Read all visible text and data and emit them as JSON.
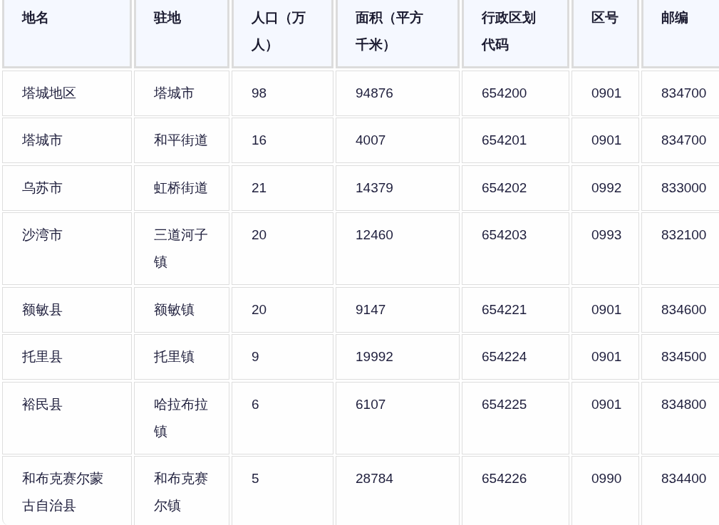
{
  "table": {
    "columns": [
      "地名",
      "驻地",
      "人口（万人）",
      "面积（平方千米）",
      "行政区划代码",
      "区号",
      "邮编"
    ],
    "rows": [
      [
        "塔城地区",
        "塔城市",
        "98",
        "94876",
        "654200",
        "0901",
        "834700"
      ],
      [
        "塔城市",
        "和平街道",
        "16",
        "4007",
        "654201",
        "0901",
        "834700"
      ],
      [
        "乌苏市",
        "虹桥街道",
        "21",
        "14379",
        "654202",
        "0992",
        "833000"
      ],
      [
        "沙湾市",
        "三道河子镇",
        "20",
        "12460",
        "654203",
        "0993",
        "832100"
      ],
      [
        "额敏县",
        "额敏镇",
        "20",
        "9147",
        "654221",
        "0901",
        "834600"
      ],
      [
        "托里县",
        "托里镇",
        "9",
        "19992",
        "654224",
        "0901",
        "834500"
      ],
      [
        "裕民县",
        "哈拉布拉镇",
        "6",
        "6107",
        "654225",
        "0901",
        "834800"
      ],
      [
        "和布克赛尔蒙古自治县",
        "和布克赛尔镇",
        "5",
        "28784",
        "654226",
        "0990",
        "834400"
      ]
    ]
  }
}
